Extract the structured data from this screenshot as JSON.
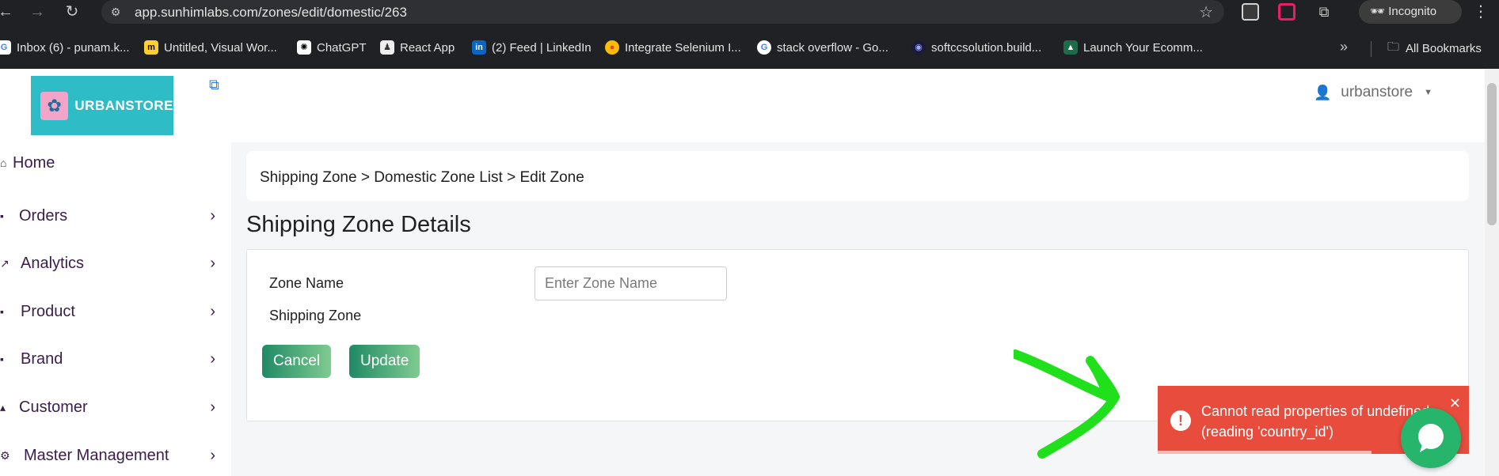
{
  "browser": {
    "url": "app.sunhimlabs.com/zones/edit/domestic/263",
    "incognito_label": "Incognito",
    "bookmarks": [
      {
        "label": "Inbox (6) - punam.k...",
        "icon": "google-icon"
      },
      {
        "label": "Untitled, Visual Wor...",
        "icon": "miro-icon"
      },
      {
        "label": "ChatGPT",
        "icon": "chatgpt-icon"
      },
      {
        "label": "React App",
        "icon": "react-app-icon"
      },
      {
        "label": "(2) Feed | LinkedIn",
        "icon": "linkedin-icon"
      },
      {
        "label": "Integrate Selenium I...",
        "icon": "chrome-icon"
      },
      {
        "label": "stack overflow - Go...",
        "icon": "google-icon"
      },
      {
        "label": "softccsolution.build...",
        "icon": "site-icon"
      },
      {
        "label": "Launch Your Ecomm...",
        "icon": "shop-icon"
      }
    ],
    "all_bookmarks_label": "All Bookmarks"
  },
  "brand": {
    "logo_text": "URBANSTORE"
  },
  "sidebar": {
    "items": [
      {
        "label": "Home",
        "has_chevron": false
      },
      {
        "label": "Orders",
        "has_chevron": true
      },
      {
        "label": "Analytics",
        "has_chevron": true
      },
      {
        "label": "Product",
        "has_chevron": true
      },
      {
        "label": "Brand",
        "has_chevron": true
      },
      {
        "label": "Customer",
        "has_chevron": true
      },
      {
        "label": "Master Management",
        "has_chevron": true
      }
    ]
  },
  "header": {
    "username": "urbanstore"
  },
  "breadcrumb": {
    "text": "Shipping Zone > Domestic Zone List > Edit Zone"
  },
  "page": {
    "title": "Shipping Zone Details",
    "zone_name_label": "Zone Name",
    "zone_name_placeholder": "Enter Zone Name",
    "zone_name_value": "",
    "shipping_zone_label": "Shipping Zone",
    "cancel_label": "Cancel",
    "update_label": "Update"
  },
  "toast": {
    "message": "Cannot read properties of undefined (reading 'country_id')",
    "close": "✕"
  },
  "colors": {
    "accent": "#2ebcc6",
    "error": "#e74c3c",
    "button": "#1f8a65",
    "chat": "#27b46b",
    "annotation": "#1fe01a"
  }
}
